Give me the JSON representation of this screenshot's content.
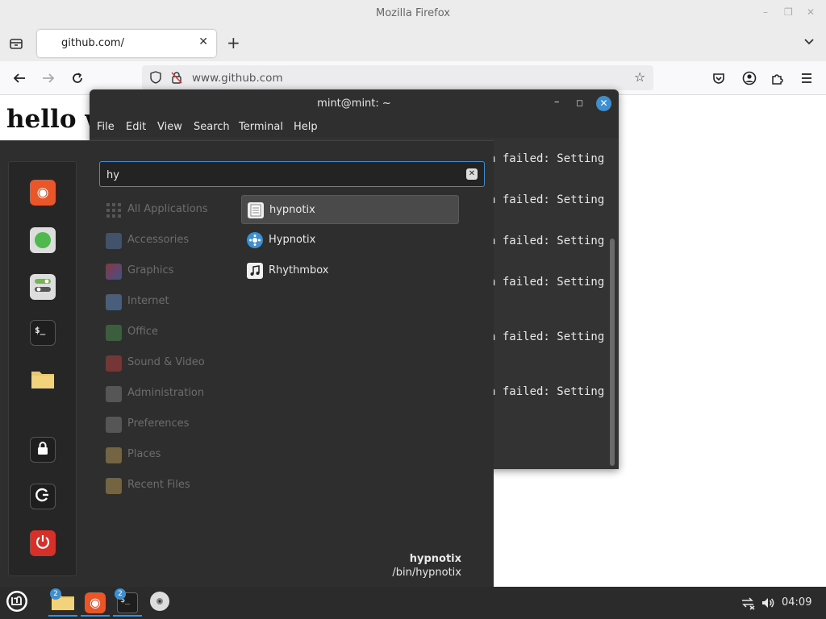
{
  "firefox": {
    "window_title": "Mozilla Firefox",
    "tab_title": "github.com/",
    "url": "www.github.com",
    "page_heading": "hello w",
    "colors": {
      "chrome": "#ececec",
      "navbar": "#f9f9fb"
    }
  },
  "terminal": {
    "title": "mint@mint: ~",
    "menu": [
      "File",
      "Edit",
      "View",
      "Search",
      "Terminal",
      "Help"
    ],
    "lines": [
      "a failed: Setting",
      "a failed: Setting",
      "a failed: Setting",
      "a failed: Setting",
      "a failed: Setting",
      "a failed: Setting"
    ]
  },
  "mint_menu": {
    "search_value": "hy",
    "favorites": [
      {
        "name": "firefox",
        "icon": "firefox-icon",
        "color": "#e8562a"
      },
      {
        "name": "software-manager",
        "icon": "software-manager-icon",
        "color": "#4fb84f"
      },
      {
        "name": "settings",
        "icon": "settings-toggle-icon",
        "color": "#7ab05c"
      },
      {
        "name": "terminal",
        "icon": "terminal-icon",
        "color": "#1e1e1e"
      },
      {
        "name": "files",
        "icon": "folder-icon",
        "color": "#e9c76a"
      },
      {
        "name": "lock-screen",
        "icon": "lock-icon",
        "color": "#1e1e1e"
      },
      {
        "name": "logout",
        "icon": "logout-icon",
        "color": "#1e1e1e"
      },
      {
        "name": "shutdown",
        "icon": "power-icon",
        "color": "#d6302a"
      }
    ],
    "categories": [
      {
        "label": "All Applications",
        "icon": "grid-icon",
        "color": "#777777"
      },
      {
        "label": "Accessories",
        "icon": "accessories-icon",
        "color": "#5a7fb5"
      },
      {
        "label": "Graphics",
        "icon": "graphics-icon",
        "color": "#b05ab0"
      },
      {
        "label": "Internet",
        "icon": "cloud-icon",
        "color": "#6a9ad6"
      },
      {
        "label": "Office",
        "icon": "office-icon",
        "color": "#4f9a4f"
      },
      {
        "label": "Sound & Video",
        "icon": "play-icon",
        "color": "#d04040"
      },
      {
        "label": "Administration",
        "icon": "admin-icon",
        "color": "#888888"
      },
      {
        "label": "Preferences",
        "icon": "preferences-icon",
        "color": "#888888"
      },
      {
        "label": "Places",
        "icon": "folder-icon",
        "color": "#c9a65a"
      },
      {
        "label": "Recent Files",
        "icon": "recent-folder-icon",
        "color": "#c9a65a"
      }
    ],
    "results": [
      {
        "label": "hypnotix",
        "icon": "document-icon",
        "selected": true
      },
      {
        "label": "Hypnotix",
        "icon": "hypnotix-icon",
        "selected": false
      },
      {
        "label": "Rhythmbox",
        "icon": "music-note-icon",
        "selected": false
      }
    ],
    "description": {
      "name": "hypnotix",
      "path": "/bin/hypnotix"
    }
  },
  "taskbar": {
    "files_badge": "2",
    "terminal_badge": "2",
    "clock": "04:09",
    "accent": "#3d8fd1"
  }
}
